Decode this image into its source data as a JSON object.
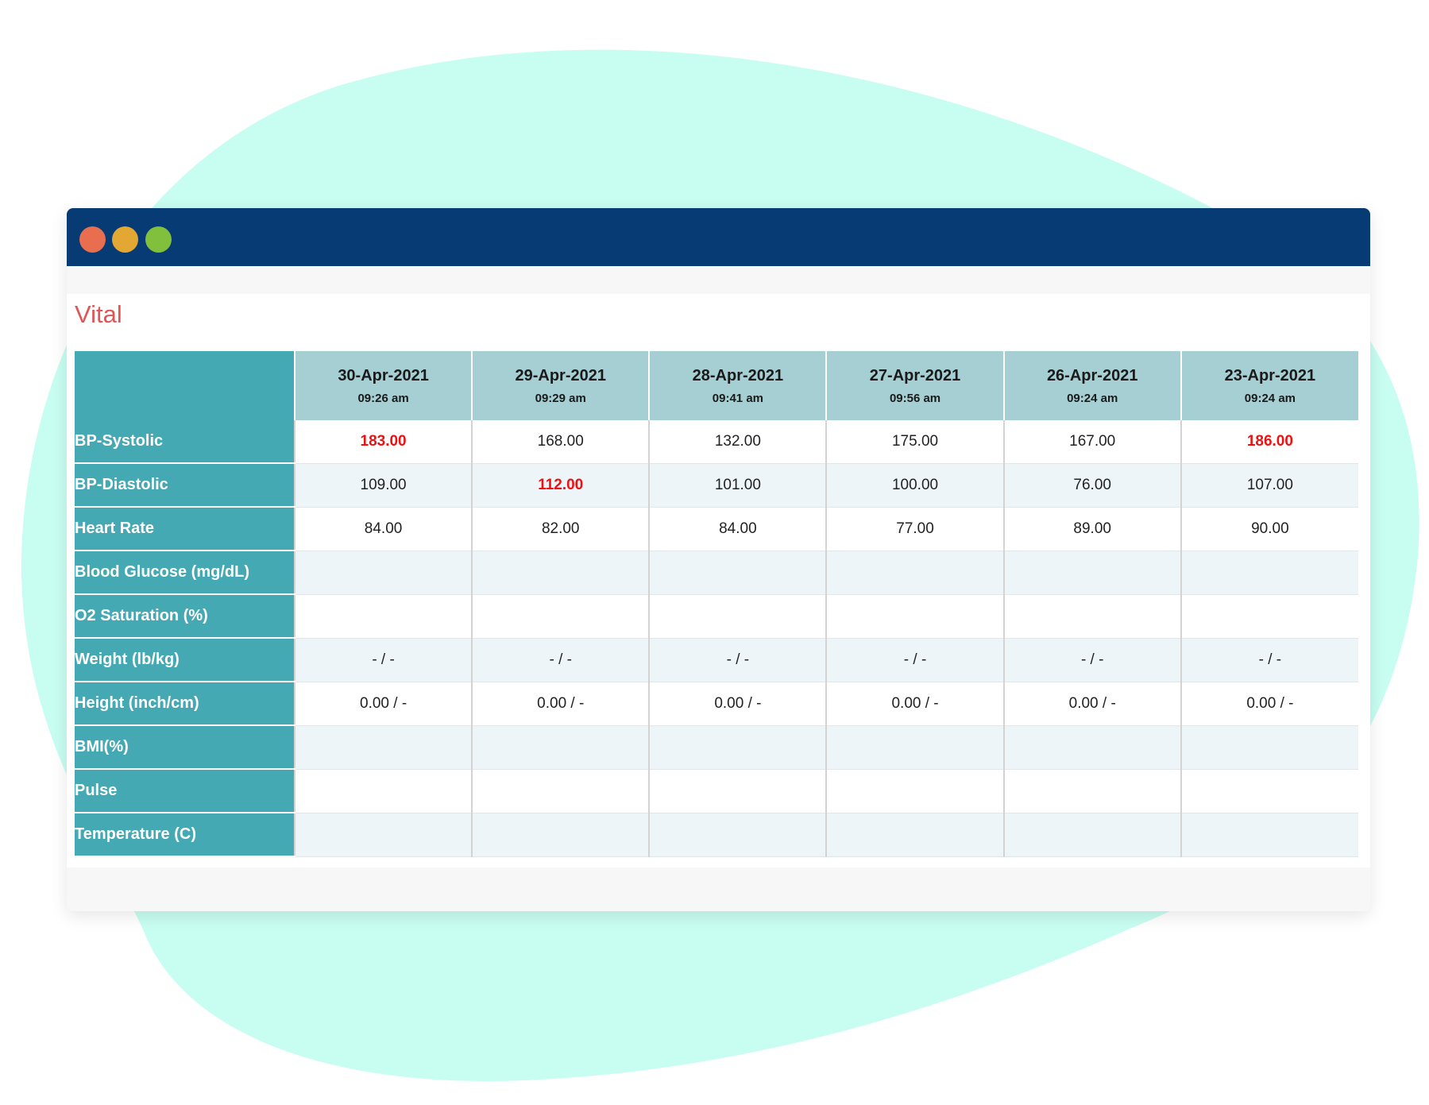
{
  "colors": {
    "background_blob": "#c8fdf1",
    "titlebar": "#073b73",
    "window_controls": [
      "#e86e4f",
      "#e3a834",
      "#80c03c"
    ],
    "title": "#e05555",
    "row_header": "#45a9b3",
    "date_header": "#a6cfd3",
    "alert_value": "#ee1111"
  },
  "window": {
    "controls": [
      "close-dot",
      "minimize-dot",
      "maximize-dot"
    ]
  },
  "section": {
    "title": "Vital"
  },
  "table": {
    "dates": [
      {
        "date": "30-Apr-2021",
        "time": "09:26 am"
      },
      {
        "date": "29-Apr-2021",
        "time": "09:29 am"
      },
      {
        "date": "28-Apr-2021",
        "time": "09:41 am"
      },
      {
        "date": "27-Apr-2021",
        "time": "09:56 am"
      },
      {
        "date": "26-Apr-2021",
        "time": "09:24 am"
      },
      {
        "date": "23-Apr-2021",
        "time": "09:24 am"
      }
    ],
    "rows": [
      {
        "label": "BP-Systolic",
        "values": [
          "183.00",
          "168.00",
          "132.00",
          "175.00",
          "167.00",
          "186.00"
        ],
        "alerts": [
          true,
          false,
          false,
          false,
          false,
          true
        ]
      },
      {
        "label": "BP-Diastolic",
        "values": [
          "109.00",
          "112.00",
          "101.00",
          "100.00",
          "76.00",
          "107.00"
        ],
        "alerts": [
          false,
          true,
          false,
          false,
          false,
          false
        ]
      },
      {
        "label": "Heart Rate",
        "values": [
          "84.00",
          "82.00",
          "84.00",
          "77.00",
          "89.00",
          "90.00"
        ],
        "alerts": [
          false,
          false,
          false,
          false,
          false,
          false
        ]
      },
      {
        "label": "Blood Glucose (mg/dL)",
        "values": [
          "",
          "",
          "",
          "",
          "",
          ""
        ],
        "alerts": [
          false,
          false,
          false,
          false,
          false,
          false
        ]
      },
      {
        "label": "O2 Saturation (%)",
        "values": [
          "",
          "",
          "",
          "",
          "",
          ""
        ],
        "alerts": [
          false,
          false,
          false,
          false,
          false,
          false
        ]
      },
      {
        "label": "Weight (lb/kg)",
        "values": [
          "- / -",
          "- / -",
          "- / -",
          "- / -",
          "- / -",
          "- / -"
        ],
        "alerts": [
          false,
          false,
          false,
          false,
          false,
          false
        ]
      },
      {
        "label": "Height (inch/cm)",
        "values": [
          "0.00 / -",
          "0.00 / -",
          "0.00 / -",
          "0.00 / -",
          "0.00 / -",
          "0.00 / -"
        ],
        "alerts": [
          false,
          false,
          false,
          false,
          false,
          false
        ]
      },
      {
        "label": "BMI(%)",
        "values": [
          "",
          "",
          "",
          "",
          "",
          ""
        ],
        "alerts": [
          false,
          false,
          false,
          false,
          false,
          false
        ]
      },
      {
        "label": "Pulse",
        "values": [
          "",
          "",
          "",
          "",
          "",
          ""
        ],
        "alerts": [
          false,
          false,
          false,
          false,
          false,
          false
        ]
      },
      {
        "label": "Temperature (C)",
        "values": [
          "",
          "",
          "",
          "",
          "",
          ""
        ],
        "alerts": [
          false,
          false,
          false,
          false,
          false,
          false
        ]
      }
    ]
  }
}
